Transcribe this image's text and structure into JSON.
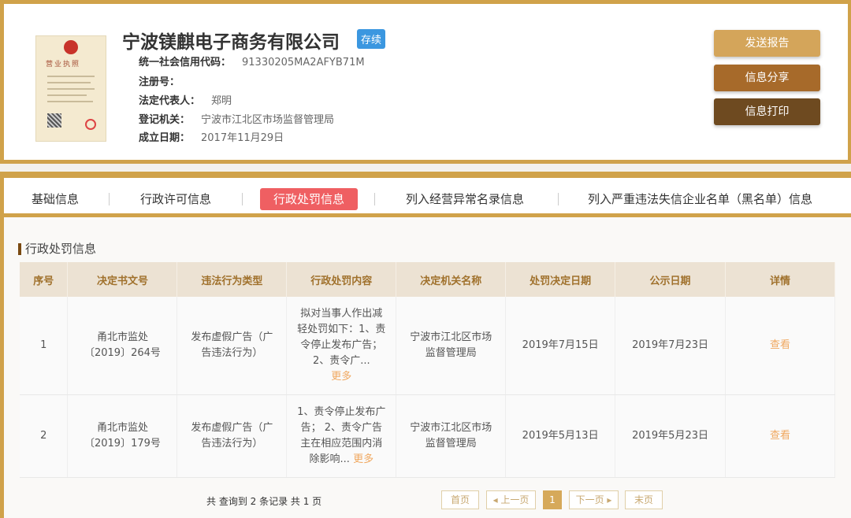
{
  "company": {
    "name": "宁波镁麒电子商务有限公司",
    "status": "存续",
    "fields": [
      {
        "label": "统一社会信用代码：",
        "value": "91330205MA2AFYB71M"
      },
      {
        "label": "注册号：",
        "value": ""
      },
      {
        "label": "法定代表人：",
        "value": "郑明"
      },
      {
        "label": "登记机关：",
        "value": "宁波市江北区市场监督管理局"
      },
      {
        "label": "成立日期：",
        "value": "2017年11月29日"
      }
    ],
    "license_text": "营业执照"
  },
  "actions": {
    "send": "发送报告",
    "share": "信息分享",
    "print": "信息打印"
  },
  "tabs": [
    "基础信息",
    "行政许可信息",
    "行政处罚信息",
    "列入经营异常名录信息",
    "列入严重违法失信企业名单（黑名单）信息"
  ],
  "section_title": "行政处罚信息",
  "table": {
    "headers": [
      "序号",
      "决定书文号",
      "违法行为类型",
      "行政处罚内容",
      "决定机关名称",
      "处罚决定日期",
      "公示日期",
      "详情"
    ],
    "rows": [
      {
        "no": "1",
        "doc": "甬北市监处〔2019〕264号",
        "type": "发布虚假广告（广告违法行为）",
        "content": "拟对当事人作出减轻处罚如下：1、责令停止发布广告；2、责令广...",
        "more": "更多",
        "org": "宁波市江北区市场监督管理局",
        "decision_date": "2019年7月15日",
        "publish_date": "2019年7月23日",
        "detail": "查看"
      },
      {
        "no": "2",
        "doc": "甬北市监处〔2019〕179号",
        "type": "发布虚假广告（广告违法行为）",
        "content": "1、责令停止发布广告； 2、责令广告主在相应范围内消除影响...",
        "more": "更多",
        "org": "宁波市江北区市场监督管理局",
        "decision_date": "2019年5月13日",
        "publish_date": "2019年5月23日",
        "detail": "查看"
      }
    ]
  },
  "pagination": {
    "summary": "共 查询到 2 条记录 共 1 页",
    "first": "首页",
    "prev": "◂ 上一页",
    "current": "1",
    "next": "下一页 ▸",
    "last": "末页"
  }
}
